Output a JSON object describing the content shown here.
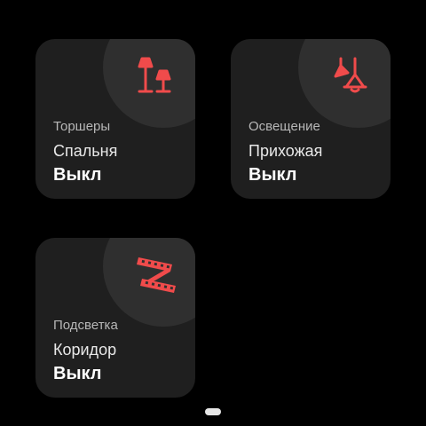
{
  "colors": {
    "background": "#000000",
    "tile": "#1f1f1f",
    "tile_circle": "#2f2f2f",
    "accent": "#f04b4b",
    "state_text": "#ffffff",
    "category_text": "#b7b7b7"
  },
  "tiles": [
    {
      "icon": "floor-lamps-icon",
      "category": "Торшеры",
      "room": "Спальня",
      "state": "Выкл"
    },
    {
      "icon": "ceiling-lights-icon",
      "category": "Освещение",
      "room": "Прихожая",
      "state": "Выкл"
    },
    {
      "icon": "led-strip-icon",
      "category": "Подсветка",
      "room": "Коридор",
      "state": "Выкл"
    }
  ],
  "pagination": {
    "pages": 1,
    "current": 1
  }
}
